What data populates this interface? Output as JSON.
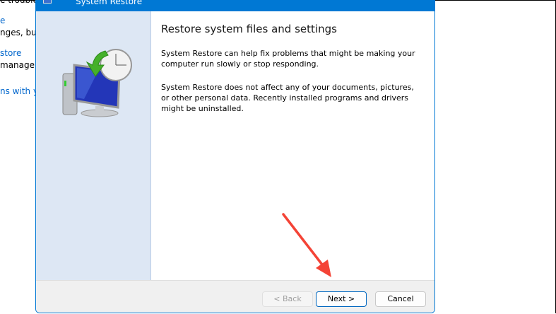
{
  "background": {
    "lines": [
      "e troublesh",
      "e",
      "nges, but",
      "store",
      "manage",
      "ns with yo"
    ]
  },
  "dialog": {
    "title": "System Restore",
    "heading": "Restore system files and settings",
    "para1": "System Restore can help fix problems that might be making your computer run slowly or stop responding.",
    "para2": "System Restore does not affect any of your documents, pictures, or other personal data. Recently installed programs and drivers might be uninstalled.",
    "buttons": {
      "back": "< Back",
      "next": "Next >",
      "cancel": "Cancel"
    }
  },
  "annotation": {
    "arrow_color": "#f44336"
  }
}
